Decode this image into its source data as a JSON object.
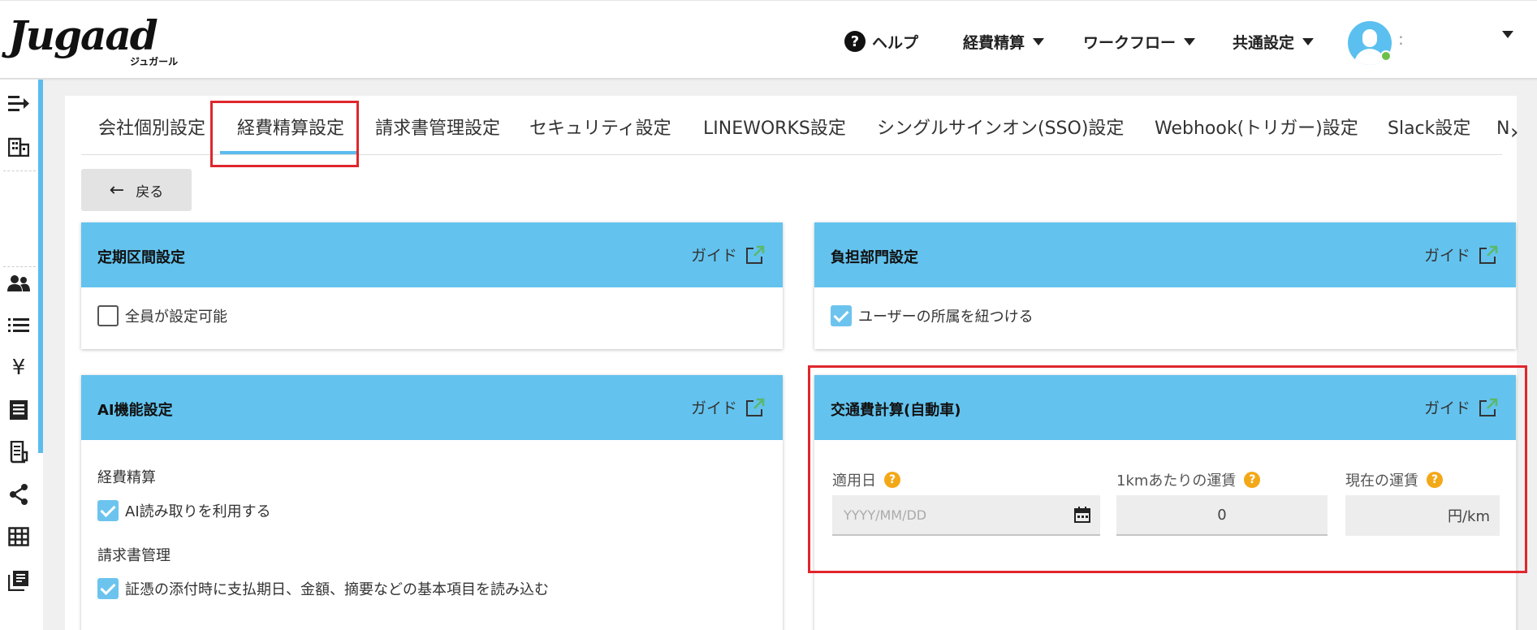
{
  "header": {
    "logo_text": "Jugaad",
    "logo_sub": "ジュガール",
    "nav": {
      "help": "ヘルプ",
      "expense": "経費精算",
      "workflow": "ワークフロー",
      "common": "共通設定"
    },
    "user_name": ":"
  },
  "tabs": [
    {
      "label": "会社個別設定"
    },
    {
      "label": "経費精算設定"
    },
    {
      "label": "請求書管理設定"
    },
    {
      "label": "セキュリティ設定"
    },
    {
      "label": "LINEWORKS設定"
    },
    {
      "label": "シングルサインオン(SSO)設定"
    },
    {
      "label": "Webhook(トリガー)設定"
    },
    {
      "label": "Slack設定"
    },
    {
      "label": "N"
    }
  ],
  "back_label": "戻る",
  "guide_label": "ガイド",
  "cards": {
    "commute": {
      "title": "定期区間設定",
      "option": "全員が設定可能",
      "checked": false
    },
    "dept": {
      "title": "負担部門設定",
      "option": "ユーザーの所属を紐つける",
      "checked": true
    },
    "ai": {
      "title": "AI機能設定",
      "section1": "経費精算",
      "option1": "AI読み取りを利用する",
      "section2": "請求書管理",
      "option2": "証憑の添付時に支払期日、金額、摘要などの基本項目を読み込む"
    },
    "car": {
      "title": "交通費計算(自動車)",
      "date_label": "適用日",
      "date_placeholder": "YYYY/MM/DD",
      "fare_label": "1kmあたりの運賃",
      "fare_value": "0",
      "current_label": "現在の運賃",
      "current_value": "円/km"
    }
  },
  "colors": {
    "accent": "#63c3ee",
    "highlight": "#e0262c",
    "help_badge": "#f3a818"
  }
}
